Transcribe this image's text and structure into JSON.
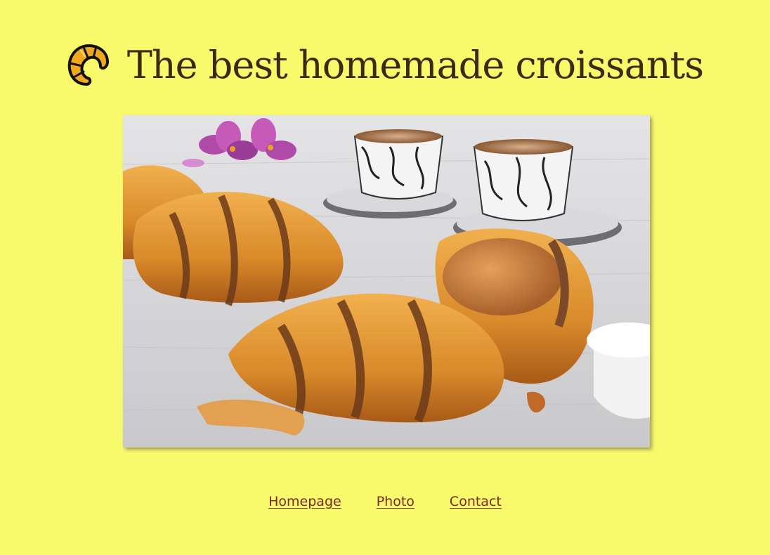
{
  "header": {
    "logo_icon": "croissant-icon",
    "title": "The best homemade croissants"
  },
  "main": {
    "photo_alt": "Croissants with coffee cups, flowers and cream"
  },
  "nav": {
    "links": [
      {
        "label": "Homepage"
      },
      {
        "label": "Photo"
      },
      {
        "label": "Contact"
      }
    ]
  },
  "colors": {
    "background": "#f8fa6c",
    "title_text": "#3a2b12",
    "link": "#7a2a1a",
    "logo_fill": "#f2a81e"
  }
}
